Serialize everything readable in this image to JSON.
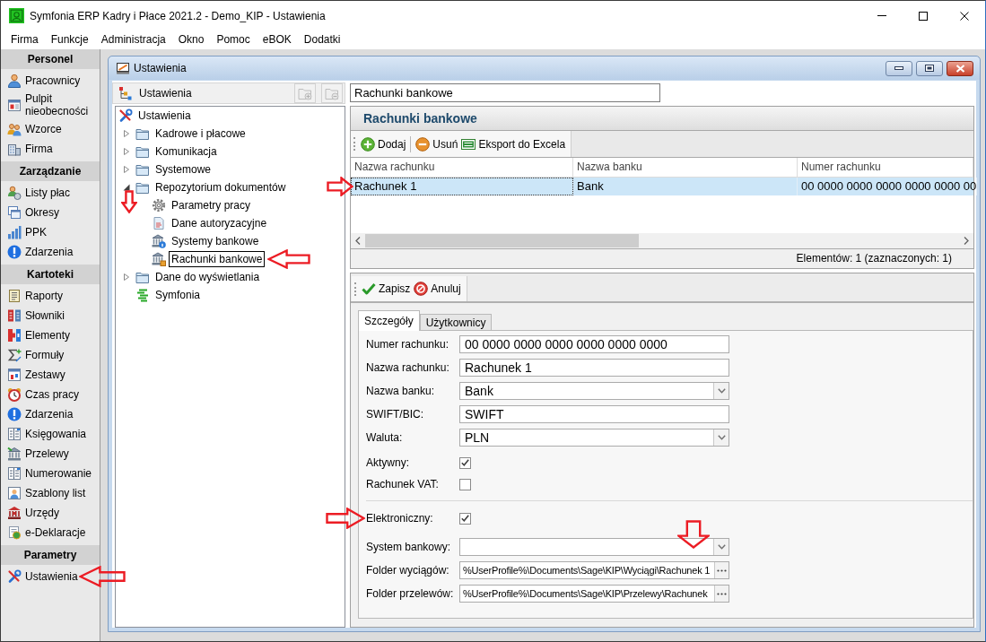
{
  "window": {
    "title": "Symfonia ERP Kadry i Płace 2021.2 - Demo_KIP - Ustawienia"
  },
  "menu_bar": [
    "Firma",
    "Funkcje",
    "Administracja",
    "Okno",
    "Pomoc",
    "eBOK",
    "Dodatki"
  ],
  "sidebar": {
    "groups": [
      {
        "title": "Personel",
        "items": [
          {
            "label": "Pracownicy"
          },
          {
            "label": "Pulpit nieobecności"
          },
          {
            "label": "Wzorce"
          },
          {
            "label": "Firma"
          }
        ]
      },
      {
        "title": "Zarządzanie",
        "items": [
          {
            "label": "Listy płac"
          },
          {
            "label": "Okresy"
          },
          {
            "label": "PPK"
          },
          {
            "label": "Zdarzenia"
          }
        ]
      },
      {
        "title": "Kartoteki",
        "items": [
          {
            "label": "Raporty"
          },
          {
            "label": "Słowniki"
          },
          {
            "label": "Elementy"
          },
          {
            "label": "Formuły"
          },
          {
            "label": "Zestawy"
          },
          {
            "label": "Czas pracy"
          },
          {
            "label": "Zdarzenia"
          },
          {
            "label": "Księgowania"
          },
          {
            "label": "Przelewy"
          },
          {
            "label": "Numerowanie"
          },
          {
            "label": "Szablony list"
          },
          {
            "label": "Urzędy"
          },
          {
            "label": "e-Deklaracje"
          }
        ]
      },
      {
        "title": "Parametry",
        "items": [
          {
            "label": "Ustawienia",
            "arrow_marked": true
          }
        ]
      }
    ]
  },
  "child_window": {
    "title": "Ustawienia"
  },
  "tree_panel": {
    "title": "Ustawienia",
    "tool_buttons": [
      {
        "disabled": true
      },
      {
        "disabled": true
      }
    ],
    "tree": [
      {
        "label": "Ustawienia",
        "selected": false,
        "children": [
          {
            "label": "Kadrowe i płacowe",
            "expanded": false,
            "selected": false,
            "arrow_marked": false
          },
          {
            "label": "Komunikacja",
            "expanded": false,
            "selected": false,
            "arrow_marked": false
          },
          {
            "label": "Systemowe",
            "expanded": false,
            "selected": false,
            "arrow_marked": false
          },
          {
            "label": "Repozytorium dokumentów",
            "expanded": true,
            "selected": false,
            "arrow_marked": true,
            "children": [
              {
                "label": "Parametry pracy",
                "selected": false,
                "arrow_marked": false
              },
              {
                "label": "Dane autoryzacyjne",
                "selected": false,
                "arrow_marked": false
              },
              {
                "label": "Systemy bankowe",
                "selected": false,
                "arrow_marked": false
              },
              {
                "label": "Rachunki bankowe",
                "selected": true,
                "arrow_marked": true
              }
            ]
          },
          {
            "label": "Dane do wyświetlania",
            "expanded": false,
            "selected": false,
            "arrow_marked": false
          },
          {
            "label": "Symfonia",
            "selected": false,
            "arrow_marked": false
          }
        ]
      }
    ]
  },
  "search": {
    "value": "Rachunki bankowe"
  },
  "list_panel": {
    "title": "Rachunki bankowe",
    "toolbar": [
      "Dodaj",
      "Usuń",
      "Eksport do Excela"
    ],
    "columns": [
      "Nazwa rachunku",
      "Nazwa banku",
      "Numer rachunku"
    ],
    "rows": [
      {
        "cells": [
          "Rachunek 1",
          "Bank",
          "00 0000 0000 0000 0000 0000 00"
        ],
        "selected": true,
        "arrow_marked": true
      }
    ],
    "status": "Elementów: 1 (zaznaczonych: 1)"
  },
  "detail_panel": {
    "toolbar": [
      "Zapisz",
      "Anuluj"
    ],
    "tabs": [
      {
        "label": "Szczegóły",
        "selected": true
      },
      {
        "label": "Użytkownicy",
        "selected": false
      }
    ],
    "sections": [
      {
        "fields": [
          {
            "label": "Numer rachunku:",
            "kind": "text",
            "value": "00 0000 0000 0000 0000 0000 0000"
          },
          {
            "label": "Nazwa rachunku:",
            "kind": "text",
            "value": "Rachunek 1"
          },
          {
            "label": "Nazwa banku:",
            "kind": "combo",
            "value": "Bank"
          },
          {
            "label": "SWIFT/BIC:",
            "kind": "text",
            "value": "SWIFT"
          },
          {
            "label": "Waluta:",
            "kind": "combo",
            "value": "PLN"
          },
          {
            "label": "Aktywny:",
            "kind": "checkbox",
            "checked": true
          },
          {
            "label": "Rachunek VAT:",
            "kind": "checkbox",
            "checked": false
          }
        ]
      },
      {
        "fields": [
          {
            "label": "Elektroniczny:",
            "kind": "checkbox",
            "checked": true,
            "arrow_marked": true
          },
          {
            "label": "System bankowy:",
            "kind": "combo",
            "arrow_marked": true
          },
          {
            "label": "Folder wyciągów:",
            "kind": "path",
            "value": "%UserProfile%\\Documents\\Sage\\KIP\\Wyciągi\\Rachunek 1",
            "arrow_marked": false
          },
          {
            "label": "Folder przelewów:",
            "kind": "path",
            "value": "%UserProfile%\\Documents\\Sage\\KIP\\Przelewy\\Rachunek",
            "arrow_marked": false
          }
        ]
      }
    ]
  }
}
